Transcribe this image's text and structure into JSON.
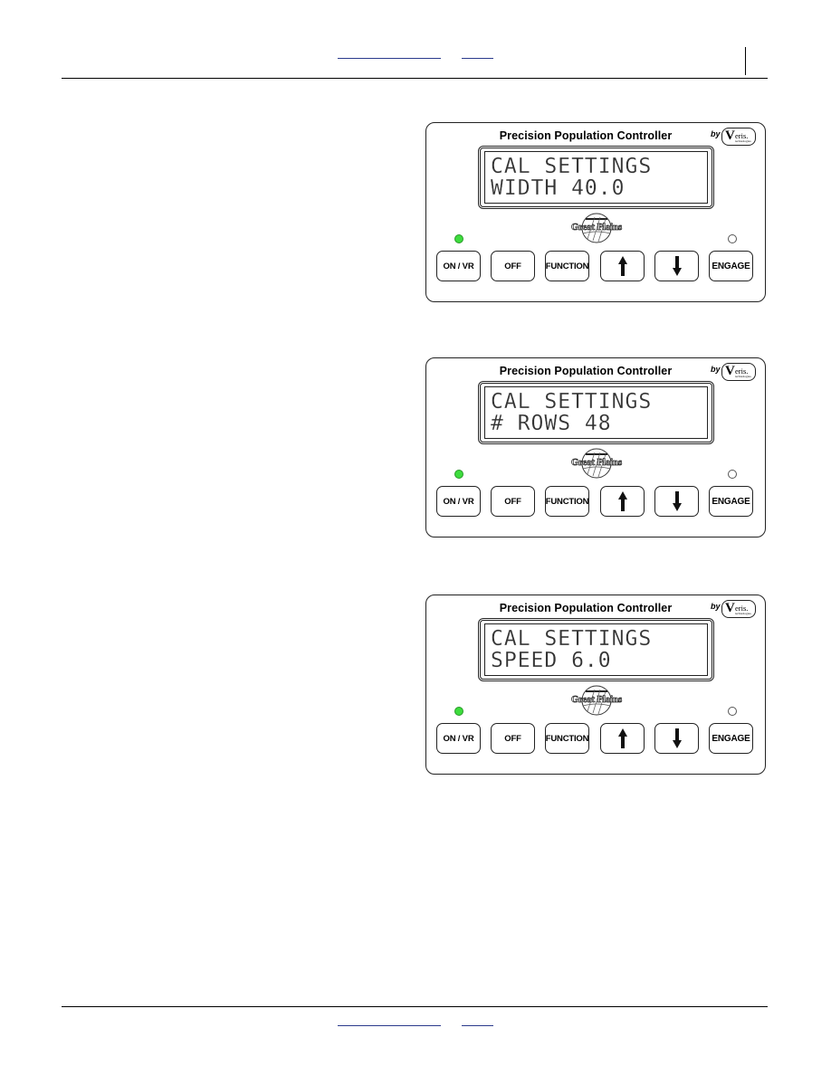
{
  "header": {
    "links": [
      {
        "label": "",
        "name": "header-link-manual"
      },
      {
        "label": "",
        "name": "header-link-contents"
      }
    ]
  },
  "footer": {
    "links": [
      {
        "label": "",
        "name": "footer-link-manual"
      },
      {
        "label": "",
        "name": "footer-link-contents"
      }
    ]
  },
  "colors": {
    "link_underline": "#2b3a8c",
    "led_on": "#3ddc3d",
    "led_off": "#ffffff"
  },
  "panels": [
    {
      "title": "Precision Population Controller",
      "by_label": "by",
      "brand": {
        "mark": "V",
        "name": "eris.",
        "sub": "technologies"
      },
      "logo_label": "Great Plains",
      "lcd": {
        "line1": "CAL SETTINGS",
        "line2": "WIDTH 40.0"
      },
      "leds": {
        "on_vr": "on",
        "engage": "off"
      },
      "buttons": [
        "ON / VR",
        "OFF",
        "FUNCTION",
        "up-arrow",
        "down-arrow",
        "ENGAGE"
      ]
    },
    {
      "title": "Precision Population Controller",
      "by_label": "by",
      "brand": {
        "mark": "V",
        "name": "eris.",
        "sub": "technologies"
      },
      "logo_label": "Great Plains",
      "lcd": {
        "line1": "CAL SETTINGS",
        "line2": "# ROWS 48"
      },
      "leds": {
        "on_vr": "on",
        "engage": "off"
      },
      "buttons": [
        "ON / VR",
        "OFF",
        "FUNCTION",
        "up-arrow",
        "down-arrow",
        "ENGAGE"
      ]
    },
    {
      "title": "Precision Population Controller",
      "by_label": "by",
      "brand": {
        "mark": "V",
        "name": "eris.",
        "sub": "technologies"
      },
      "logo_label": "Great Plains",
      "lcd": {
        "line1": "CAL SETTINGS",
        "line2": "SPEED 6.0"
      },
      "leds": {
        "on_vr": "on",
        "engage": "off"
      },
      "buttons": [
        "ON / VR",
        "OFF",
        "FUNCTION",
        "up-arrow",
        "down-arrow",
        "ENGAGE"
      ]
    }
  ]
}
